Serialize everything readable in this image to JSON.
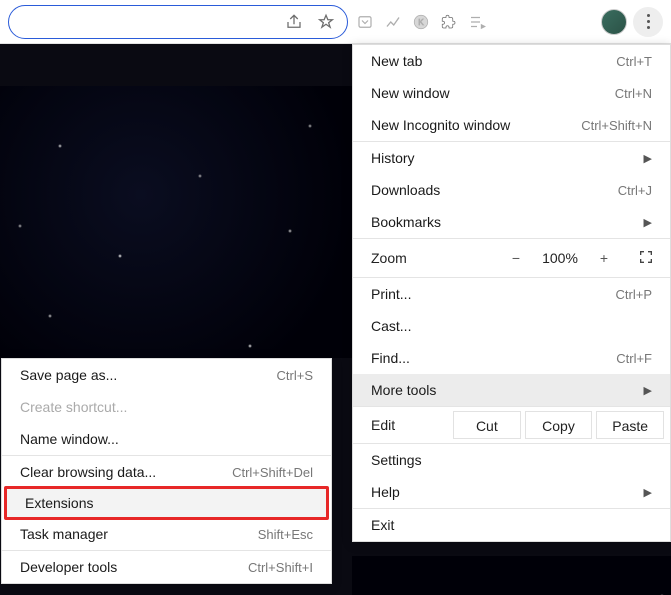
{
  "toolbar": {
    "icons": [
      "share-icon",
      "star-icon",
      "pocket-icon",
      "analytics-icon",
      "kaltura-icon",
      "extensions-icon",
      "playlist-icon"
    ],
    "avatar": "profile-avatar"
  },
  "main_menu": {
    "sections": [
      [
        {
          "label": "New tab",
          "shortcut": "Ctrl+T",
          "name": "new-tab"
        },
        {
          "label": "New window",
          "shortcut": "Ctrl+N",
          "name": "new-window"
        },
        {
          "label": "New Incognito window",
          "shortcut": "Ctrl+Shift+N",
          "name": "new-incognito"
        }
      ],
      [
        {
          "label": "History",
          "submenu": true,
          "name": "history"
        },
        {
          "label": "Downloads",
          "shortcut": "Ctrl+J",
          "name": "downloads"
        },
        {
          "label": "Bookmarks",
          "submenu": true,
          "name": "bookmarks"
        }
      ]
    ],
    "zoom": {
      "label": "Zoom",
      "minus": "−",
      "value": "100%",
      "plus": "+",
      "fullscreen": "⛶"
    },
    "sections2": [
      [
        {
          "label": "Print...",
          "shortcut": "Ctrl+P",
          "name": "print"
        },
        {
          "label": "Cast...",
          "name": "cast"
        },
        {
          "label": "Find...",
          "shortcut": "Ctrl+F",
          "name": "find"
        },
        {
          "label": "More tools",
          "submenu": true,
          "name": "more-tools",
          "hover": true
        }
      ]
    ],
    "edit": {
      "label": "Edit",
      "cut": "Cut",
      "copy": "Copy",
      "paste": "Paste"
    },
    "sections3": [
      [
        {
          "label": "Settings",
          "name": "settings"
        },
        {
          "label": "Help",
          "submenu": true,
          "name": "help"
        }
      ],
      [
        {
          "label": "Exit",
          "name": "exit"
        }
      ]
    ]
  },
  "sub_menu": {
    "items": [
      {
        "label": "Save page as...",
        "shortcut": "Ctrl+S",
        "name": "save-page"
      },
      {
        "label": "Create shortcut...",
        "disabled": true,
        "name": "create-shortcut"
      },
      {
        "label": "Name window...",
        "name": "name-window"
      },
      {
        "sep": true
      },
      {
        "label": "Clear browsing data...",
        "shortcut": "Ctrl+Shift+Del",
        "name": "clear-data"
      },
      {
        "label": "Extensions",
        "name": "extensions",
        "highlight": true
      },
      {
        "label": "Task manager",
        "shortcut": "Shift+Esc",
        "name": "task-manager"
      },
      {
        "sep": true
      },
      {
        "label": "Developer tools",
        "shortcut": "Ctrl+Shift+I",
        "name": "dev-tools"
      }
    ]
  }
}
